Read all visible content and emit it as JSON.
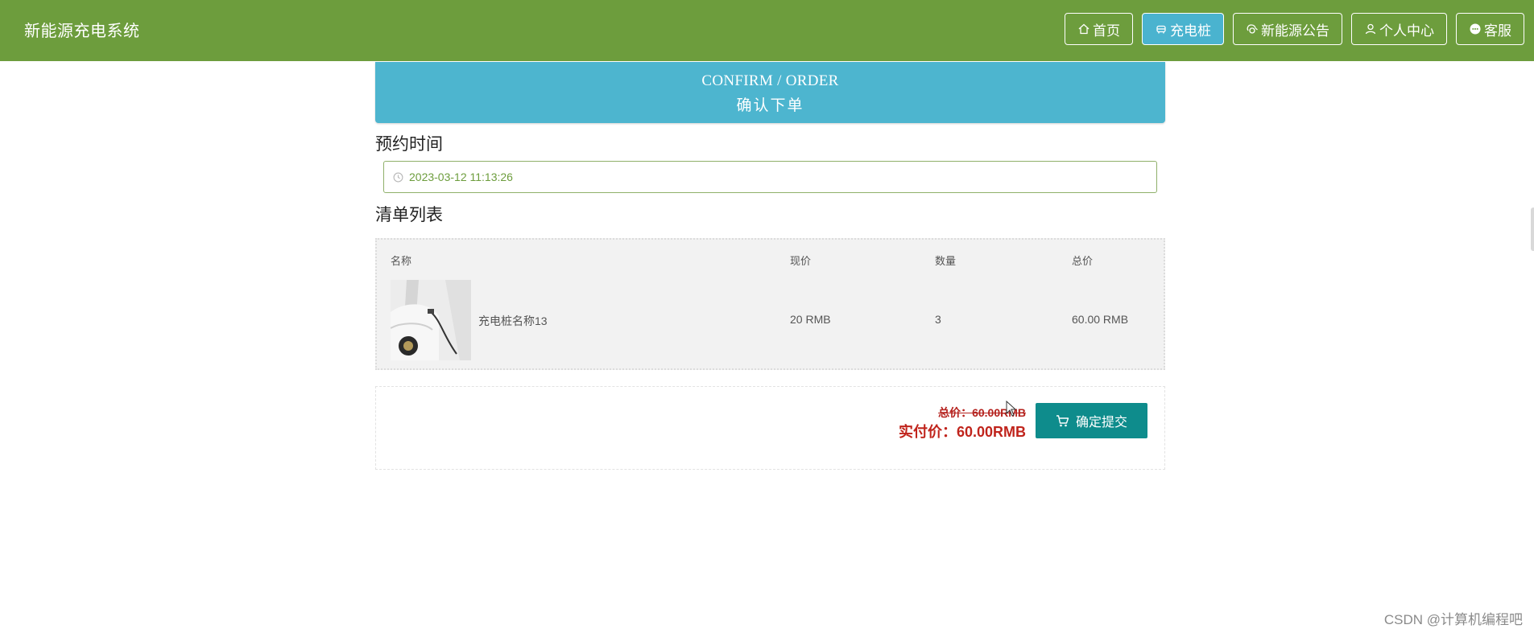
{
  "header": {
    "brand": "新能源充电系统",
    "nav": [
      {
        "label": "首页",
        "icon": "home-icon",
        "active": false
      },
      {
        "label": "充电桩",
        "icon": "charger-icon",
        "active": true
      },
      {
        "label": "新能源公告",
        "icon": "announcement-icon",
        "active": false
      },
      {
        "label": "个人中心",
        "icon": "user-icon",
        "active": false
      },
      {
        "label": "客服",
        "icon": "chat-icon",
        "active": false
      }
    ],
    "colors": {
      "bar": "#6d9d3d",
      "active_tab": "#4ab3cf"
    }
  },
  "banner": {
    "title_en": "CONFIRM / ORDER",
    "title_cn": "确认下单",
    "color": "#4db5cf"
  },
  "reservation": {
    "label": "预约时间",
    "value": "2023-03-12 11:13:26",
    "icon": "clock-icon"
  },
  "cart": {
    "label": "清单列表",
    "columns": [
      "名称",
      "现价",
      "数量",
      "总价"
    ],
    "rows": [
      {
        "name": "充电桩名称13",
        "price": "20 RMB",
        "qty": "3",
        "total": "60.00 RMB",
        "image": "car-charging-photo"
      }
    ]
  },
  "summary": {
    "original_total": "总价：60.00RMB",
    "pay_total": "实付价：60.00RMB",
    "submit_label": "确定提交",
    "submit_icon": "cart-icon",
    "button_color": "#0e8c8c",
    "price_color": "#c0241c"
  },
  "watermark": "CSDN @计算机编程吧"
}
